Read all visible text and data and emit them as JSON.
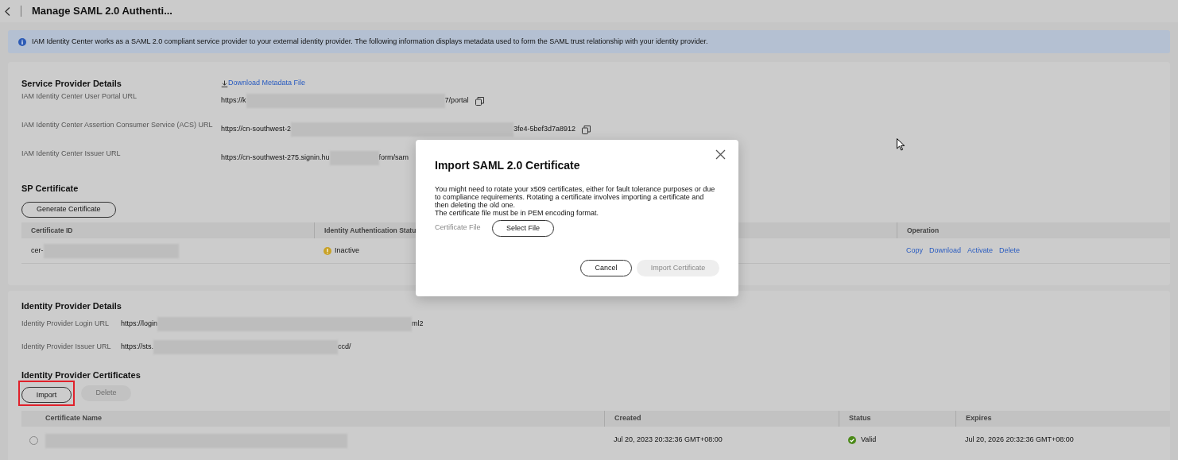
{
  "header": {
    "title": "Manage SAML 2.0 Authenti..."
  },
  "info_banner": {
    "text": "IAM Identity Center works as a SAML 2.0 compliant service provider to your external identity provider. The following information displays metadata used to form the SAML trust relationship with your identity provider."
  },
  "service_provider": {
    "title": "Service Provider Details",
    "download_link": "Download Metadata File",
    "fields": [
      {
        "label": "IAM Identity Center User Portal URL",
        "value_start": "https://k",
        "value_end": "7/portal",
        "copy_icon": true
      },
      {
        "label": "IAM Identity Center Assertion Consumer Service (ACS) URL",
        "value_start": "https://cn-southwest-2",
        "value_end": "3fe4-5bef3d7a8912",
        "copy_icon": true
      },
      {
        "label": "IAM Identity Center Issuer URL",
        "value_start": "https://cn-southwest-275.signin.hu",
        "value_end": "form/sam",
        "copy_icon": false
      }
    ]
  },
  "sp_certificate": {
    "title": "SP Certificate",
    "generate_button": "Generate Certificate",
    "columns": [
      "Certificate ID",
      "Identity Authentication Statu",
      "Operation"
    ],
    "rows": [
      {
        "id_start": "cer-",
        "status": "Inactive",
        "kind": "warning",
        "operations": [
          "Copy",
          "Download",
          "Activate",
          "Delete"
        ]
      }
    ]
  },
  "identity_provider": {
    "title": "Identity Provider Details",
    "fields": [
      {
        "label": "Identity Provider Login URL",
        "value_start": "https://login",
        "value_end": "ml2"
      },
      {
        "label": "Identity Provider Issuer URL",
        "value_start": "https://sts.",
        "value_end": "ccd/"
      }
    ]
  },
  "idp_certificates": {
    "title": "Identity Provider Certificates",
    "buttons": [
      {
        "label": "Import",
        "disabled": false,
        "highlighted": true
      },
      {
        "label": "Delete",
        "disabled": true,
        "highlighted": false
      }
    ],
    "columns": [
      "Certificate Name",
      "Created",
      "Status",
      "Expires"
    ],
    "rows": [
      {
        "selected": false,
        "created": "Jul 20, 2023 20:32:36 GMT+08:00",
        "status": "Valid",
        "kind": "valid",
        "expires": "Jul 20, 2026 20:32:36 GMT+08:00"
      }
    ]
  },
  "dialog": {
    "title": "Import SAML 2.0 Certificate",
    "paragraphs": [
      "You might need to rotate your x509 certificates, either for fault tolerance purposes or due to compliance requirements. Rotating a certificate involves importing a certificate and then deleting the old one.",
      "The certificate file must be in PEM encoding format."
    ],
    "field_label": "Certificate File",
    "select_button": "Select File",
    "buttons": [
      {
        "label": "Cancel",
        "disabled": false
      },
      {
        "label": "Import Certificate",
        "disabled": true
      }
    ]
  }
}
